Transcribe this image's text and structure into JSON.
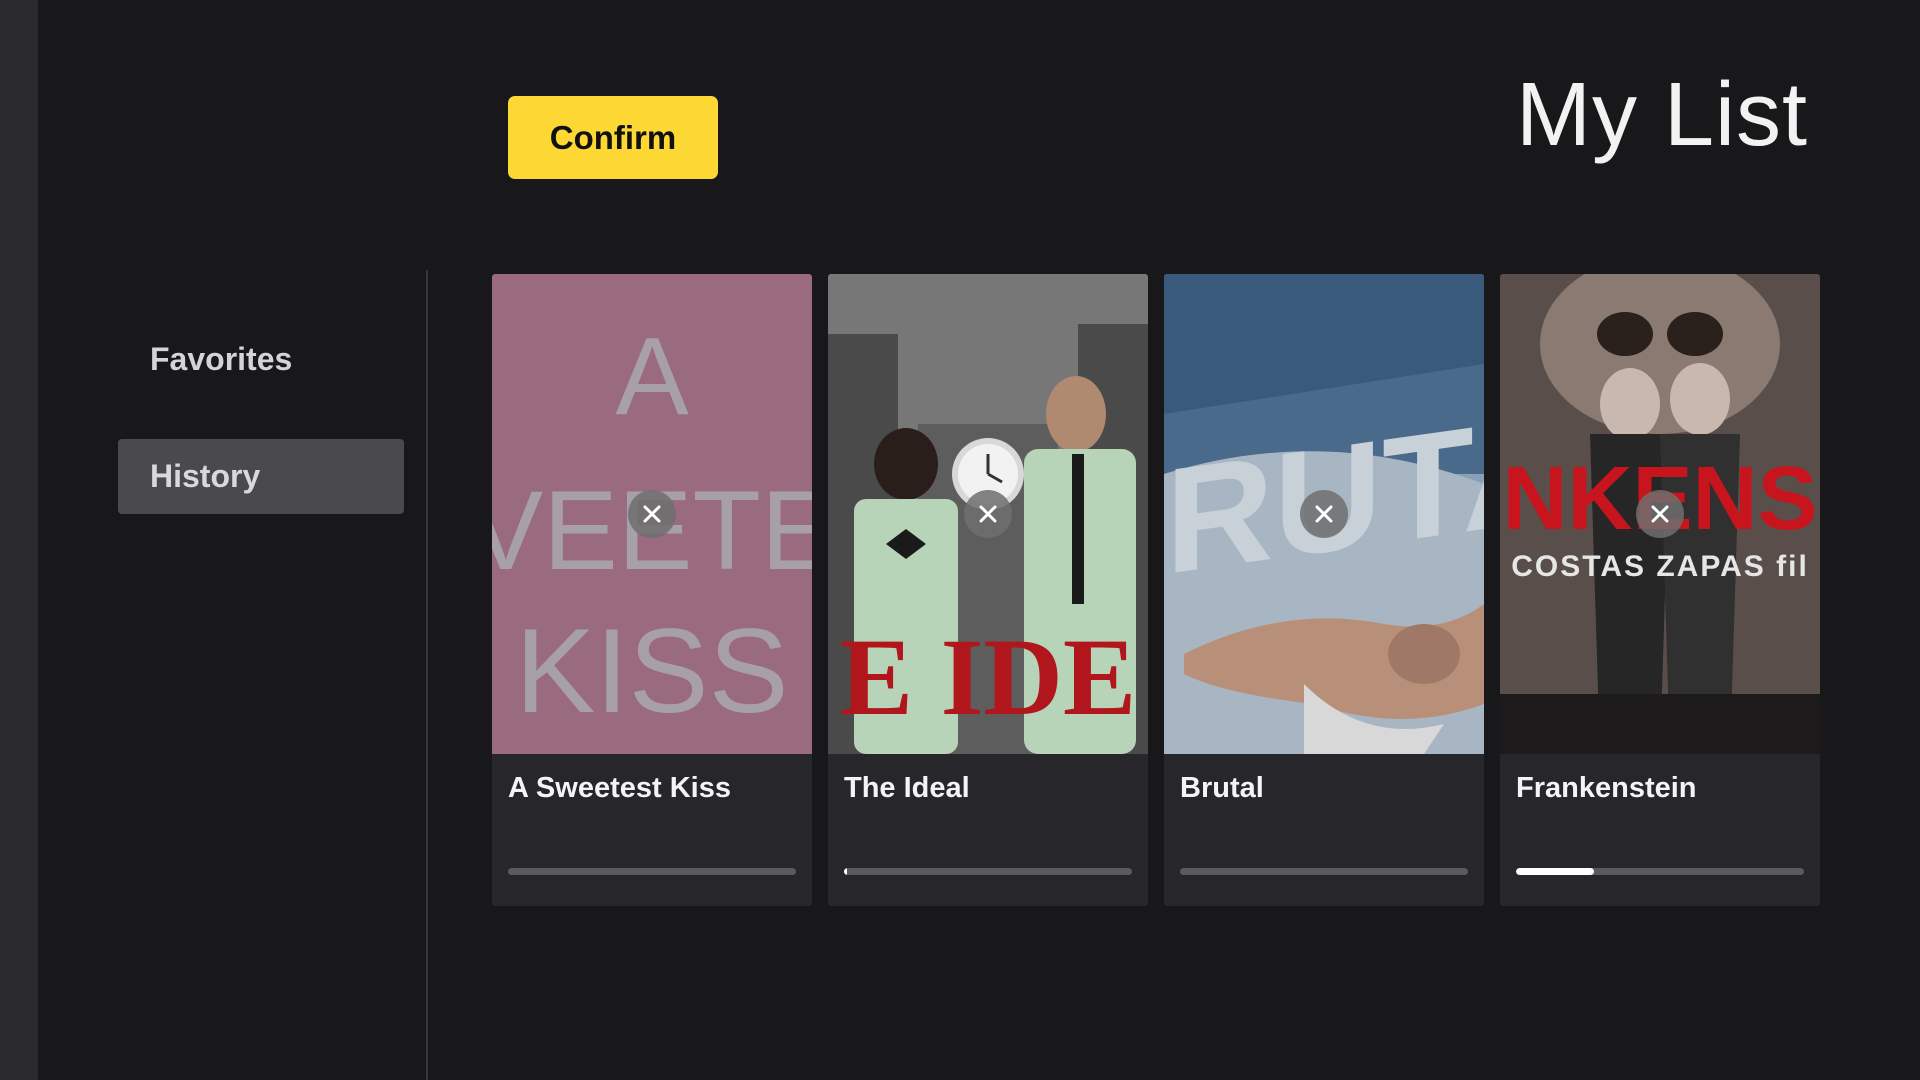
{
  "header": {
    "confirm_label": "Confirm",
    "page_title": "My List"
  },
  "sidebar": {
    "items": [
      {
        "label": "Favorites",
        "active": false
      },
      {
        "label": "History",
        "active": true
      }
    ]
  },
  "cards": [
    {
      "title": "A Sweetest Kiss",
      "progress": 0.0,
      "poster_lines": [
        "A",
        "VEETE",
        "KISS"
      ]
    },
    {
      "title": "The Ideal",
      "progress": 0.01,
      "poster_lines": [
        "E IDE"
      ]
    },
    {
      "title": "Brutal",
      "progress": 0.0,
      "poster_lines": [
        "BRUTA"
      ]
    },
    {
      "title": "Frankenstein",
      "progress": 0.27,
      "poster_lines": [
        "NKENS",
        "COSTAS ZAPAS fil"
      ]
    }
  ],
  "icons": {
    "remove": "close-icon"
  },
  "colors": {
    "accent": "#fdd835",
    "background": "#18181b",
    "card": "#26262b",
    "active_nav": "#4a4a4e"
  }
}
